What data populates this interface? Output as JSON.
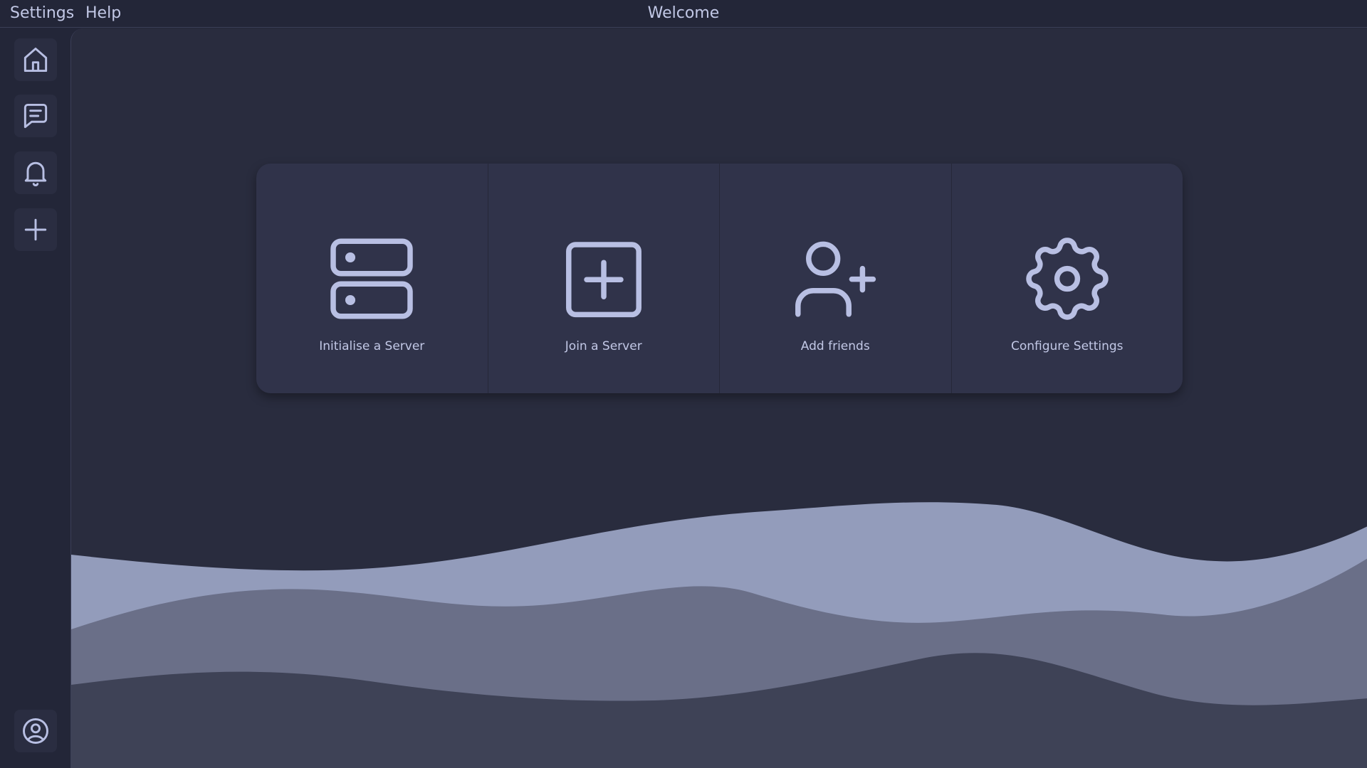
{
  "menubar": {
    "settings_label": "Settings",
    "help_label": "Help",
    "window_title": "Welcome"
  },
  "sidebar": {
    "items": [
      {
        "icon": "home-icon"
      },
      {
        "icon": "chat-icon"
      },
      {
        "icon": "bell-icon"
      },
      {
        "icon": "plus-icon"
      }
    ],
    "footer": {
      "icon": "user-circle-icon"
    }
  },
  "actions": [
    {
      "label": "Initialise a Server",
      "icon": "server-icon"
    },
    {
      "label": "Join a Server",
      "icon": "square-plus-icon"
    },
    {
      "label": "Add friends",
      "icon": "user-plus-icon"
    },
    {
      "label": "Configure Settings",
      "icon": "gear-icon"
    }
  ],
  "colors": {
    "background": "#232638",
    "main": "#292c3e",
    "card": "#30334a",
    "icon": "#b8bfe3",
    "wave_light": "#939cbb",
    "wave_mid": "#6a6f88",
    "wave_dark": "#3e4256"
  }
}
